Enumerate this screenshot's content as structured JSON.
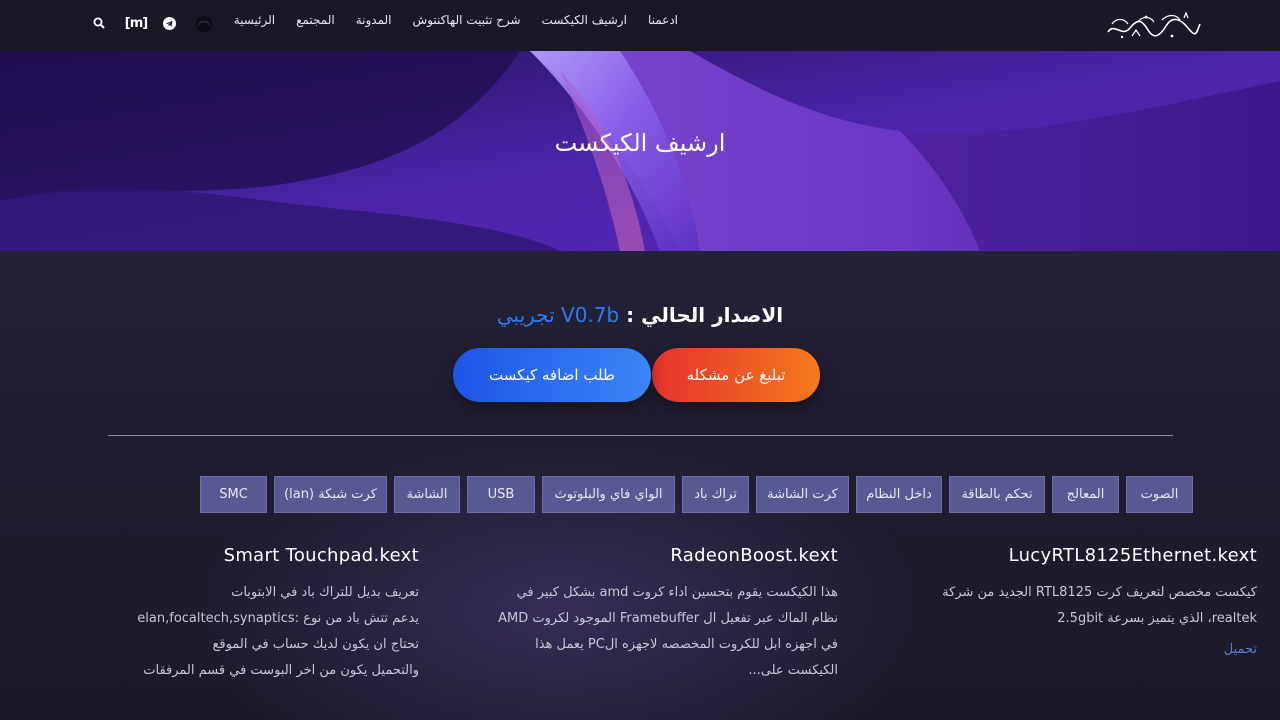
{
  "nav": {
    "logo_text": "هاكنتوش العربي",
    "items": [
      "الرئيسية",
      "المجتمع",
      "المدونة",
      "شرح تثبيت الهاكنتوش",
      "ارشيف الكيكست",
      "ادعمنا"
    ],
    "icons": [
      "avatar-icon",
      "telegram-icon",
      "matrix-icon",
      "search-icon"
    ],
    "matrix_label": "[m]"
  },
  "hero": {
    "title": "ارشيف الكيكست"
  },
  "version": {
    "label": "الاصدار الحالي :",
    "value": "V0.7b تجريبي"
  },
  "buttons": {
    "report": "تبليغ عن مشكله",
    "request": "طلب اضافه كيكست"
  },
  "categories": [
    "SMC",
    "كرت شبكة (lan)",
    "الشاشة",
    "USB",
    "الواي فاي والبلوتوث",
    "تراك باد",
    "كرت الشاشة",
    "داخل النظام",
    "تحكم بالطاقة",
    "المعالج",
    "الصوت"
  ],
  "cards": [
    {
      "title": "LucyRTL8125Ethernet.kext",
      "lines": [
        "كيكست مخصص لتعريف كرت RTL8125 الجديد من شركة",
        "realtek، الذي يتميز بسرعة 2.5gbit"
      ],
      "link": "تحميل"
    },
    {
      "title": "RadeonBoost.kext",
      "lines": [
        "هذا الكيكست يقوم بتحسين اداء كروت amd بشكل كبير في",
        "نظام الماك عبر تفعيل ال Framebuffer الموجود لكروت AMD",
        "في اجهزه ابل للكروت المخصصه لاجهزه الPC يعمل هذا",
        "الكيكست على..."
      ]
    },
    {
      "title": "Smart Touchpad.kext",
      "lines": [
        "تعريف بديل للتراك باد في الابتوبات",
        "يدعم تتش باد من نوع :elan,focaltech,synaptics",
        "تحتاج ان يكون لديك حساب في الموقع",
        "والتحميل يكون من اخر البوست في قسم المرفقات"
      ]
    }
  ]
}
